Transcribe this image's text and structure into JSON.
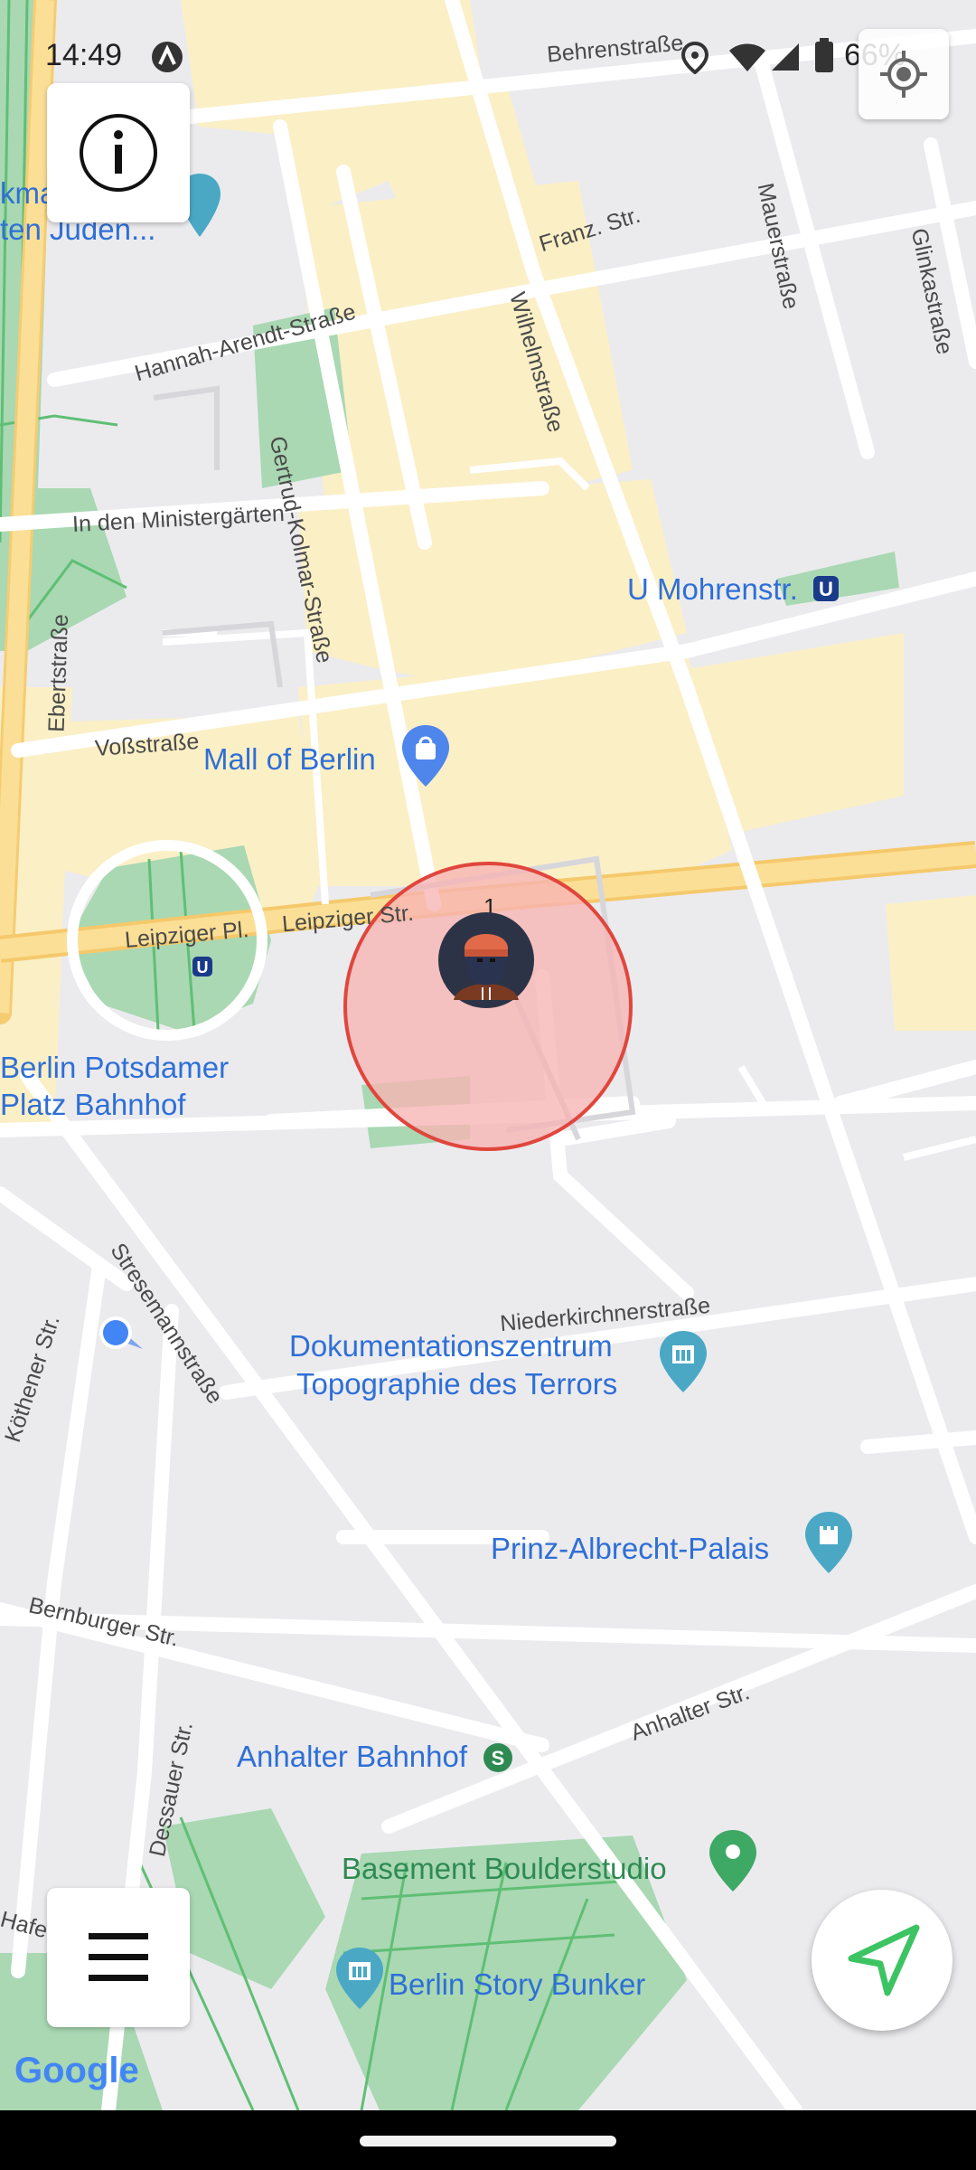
{
  "status_bar": {
    "time": "14:49",
    "battery": "66%"
  },
  "map": {
    "streets": [
      "Behrenstraße",
      "Franz. Str.",
      "Hannah-Arendt-Straße",
      "Gertrud-Kolmar-Straße",
      "Wilhelmstraße",
      "Mauerstraße",
      "Glinkastraße",
      "In den Ministergärten",
      "Ebertstraße",
      "Voßstraße",
      "Leipziger Pl.",
      "Leipziger Str.",
      "Stresemannstraße",
      "Niederkirchnerstraße",
      "Köthener Str.",
      "Bernburger Str.",
      "Dessauer Str.",
      "Anhalter Str.",
      "Hafe"
    ],
    "pois": {
      "u_mohrenstr": "U Mohrenstr.",
      "mall_of_berlin": "Mall of Berlin",
      "potsdamer_line1": "Berlin Potsdamer",
      "potsdamer_line2": "Platz Bahnhof",
      "topographie_line1": "Dokumentationszentrum",
      "topographie_line2": "Topographie des Terrors",
      "prinz_albrecht": "Prinz-Albrecht-Palais",
      "anhalter_bahnhof": "Anhalter Bahnhof",
      "basement": "Basement Boulderstudio",
      "story_bunker": "Berlin Story Bunker",
      "denkmal_line1": "kma",
      "denkmal_line2": "ten Juden..."
    },
    "zone_marker": {
      "count": "1",
      "fill": "#f7b3b3",
      "stroke": "#e0463c"
    },
    "attribution": "Google"
  },
  "controls": {
    "info_icon": "info-icon",
    "locate_icon": "my-location-icon",
    "menu_icon": "hamburger-menu-icon",
    "navigate_icon": "navigation-arrow-icon",
    "accent": "#3cc463"
  }
}
